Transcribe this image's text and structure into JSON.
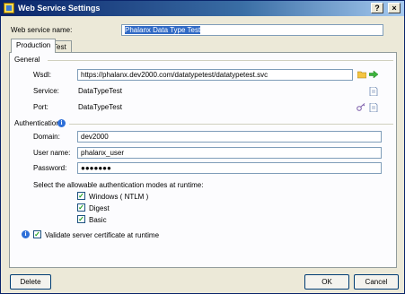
{
  "window": {
    "title": "Web Service Settings",
    "help_button": "?",
    "close_button": "×"
  },
  "service_name": {
    "label": "Web service name:",
    "value": "Phalanx Data Type Test"
  },
  "tabs": [
    {
      "label": "Production",
      "active": true
    },
    {
      "label": "Test",
      "active": false
    }
  ],
  "general": {
    "group_label": "General",
    "wsdl_label": "Wsdl:",
    "wsdl_value": "https://phalanx.dev2000.com/datatypetest/datatypetest.svc",
    "service_label": "Service:",
    "service_value": "DataTypeTest",
    "port_label": "Port:",
    "port_value": "DataTypeTest"
  },
  "authentication": {
    "group_label": "Authentication",
    "domain_label": "Domain:",
    "domain_value": "dev2000",
    "username_label": "User name:",
    "username_value": "phalanx_user",
    "password_label": "Password:",
    "password_value": "●●●●●●●",
    "modes_label": "Select the allowable authentication modes at runtime:",
    "modes": [
      {
        "label": "Windows ( NTLM )",
        "checked": true
      },
      {
        "label": "Digest",
        "checked": true
      },
      {
        "label": "Basic",
        "checked": true
      }
    ],
    "validate_label": "Validate server certificate at runtime",
    "validate_checked": true
  },
  "buttons": {
    "delete": "Delete",
    "ok": "OK",
    "cancel": "Cancel"
  },
  "icons": {
    "wsdl_open": "folder-icon",
    "wsdl_go": "green-arrow-icon",
    "service_doc": "document-icon",
    "port_settings": "key-icon",
    "port_doc": "document-icon",
    "info": "info-icon"
  },
  "colors": {
    "title_bar": "#0a246a",
    "selection": "#316ac5",
    "dialog_bg": "#ece9d8"
  }
}
